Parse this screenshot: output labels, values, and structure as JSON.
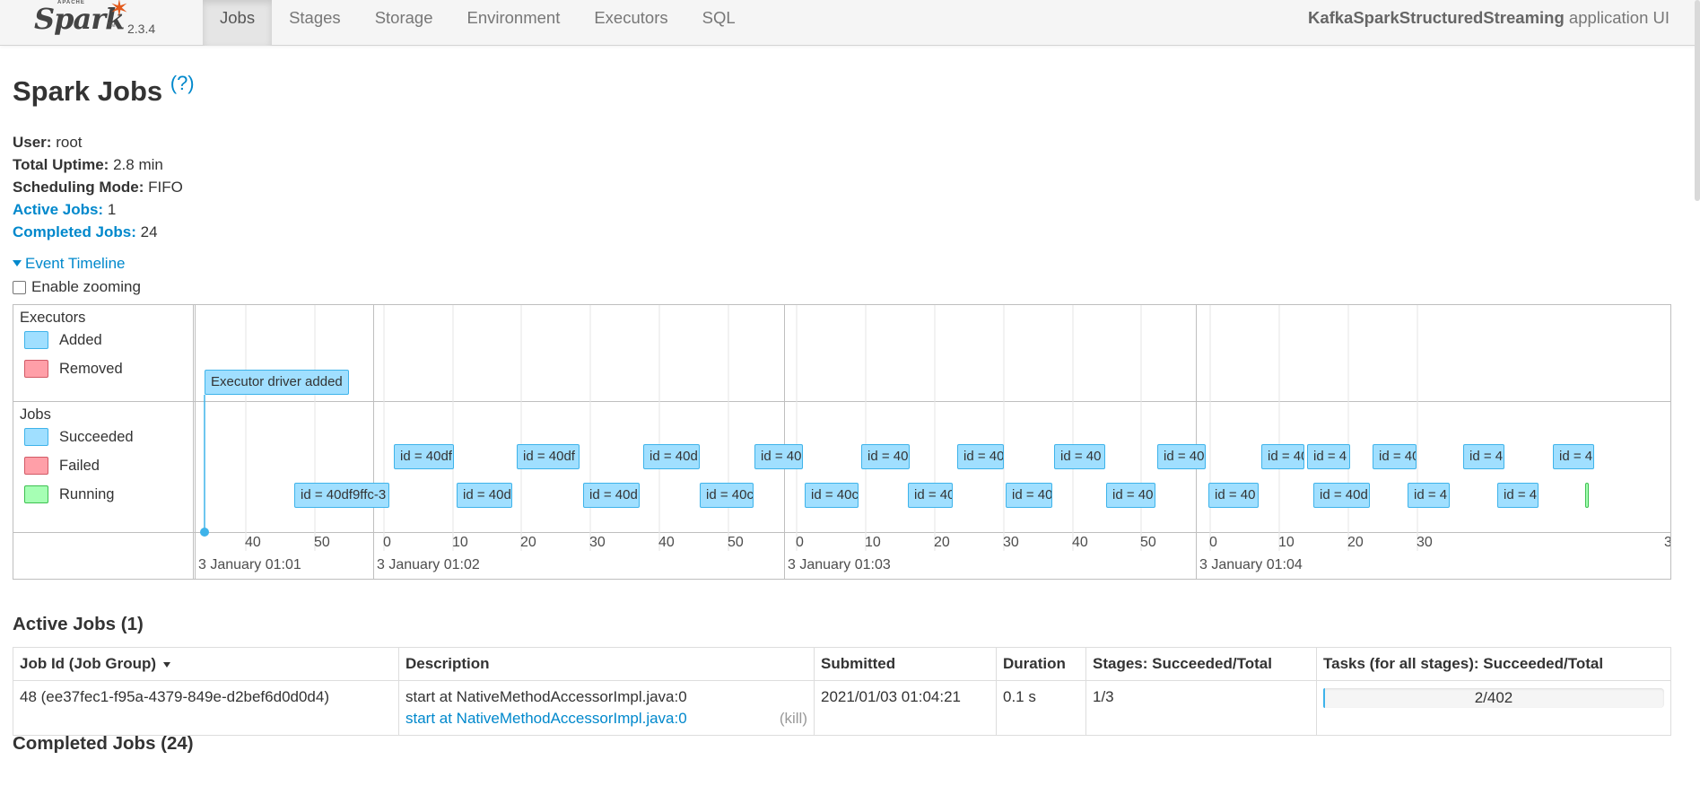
{
  "navbar": {
    "brand_apache": "APACHE",
    "brand_name": "Spark",
    "brand_tm": "TM",
    "version": "2.3.4",
    "tabs": [
      {
        "label": "Jobs",
        "active": true
      },
      {
        "label": "Stages"
      },
      {
        "label": "Storage"
      },
      {
        "label": "Environment"
      },
      {
        "label": "Executors"
      },
      {
        "label": "SQL"
      }
    ],
    "app_name": "KafkaSparkStructuredStreaming",
    "app_suffix": " application UI"
  },
  "header": {
    "title": "Spark Jobs",
    "help": "(?)"
  },
  "summary": {
    "user_label": "User:",
    "user": "root",
    "uptime_label": "Total Uptime:",
    "uptime": "2.8 min",
    "scheduling_label": "Scheduling Mode:",
    "scheduling": "FIFO",
    "active_label": "Active Jobs:",
    "active": "1",
    "completed_label": "Completed Jobs:",
    "completed": "24"
  },
  "timeline": {
    "toggle_label": "Event Timeline",
    "zoom_label": "Enable zooming",
    "zoom_checked": false,
    "executors_title": "Executors",
    "executors_legend": [
      {
        "label": "Added",
        "color": "#a0dfff"
      },
      {
        "label": "Removed",
        "color": "#ff9fa8"
      }
    ],
    "jobs_title": "Jobs",
    "jobs_legend": [
      {
        "label": "Succeeded",
        "color": "#a0dfff"
      },
      {
        "label": "Failed",
        "color": "#ff9fa8"
      },
      {
        "label": "Running",
        "color": "#a6ffb4"
      }
    ],
    "executor_event": "Executor driver added",
    "job_items": [
      {
        "label": "id = 40df9ffc-3",
        "status": "succeeded"
      },
      {
        "label": "id = 40df",
        "status": "succeeded"
      },
      {
        "label": "id = 40d",
        "status": "succeeded"
      },
      {
        "label": "id = 40df",
        "status": "succeeded"
      },
      {
        "label": "id = 40d",
        "status": "succeeded"
      },
      {
        "label": "id = 40d",
        "status": "succeeded"
      },
      {
        "label": "id = 40c",
        "status": "succeeded"
      },
      {
        "label": "id = 40",
        "status": "succeeded"
      },
      {
        "label": "id = 40c",
        "status": "succeeded"
      },
      {
        "label": "id = 40",
        "status": "succeeded"
      },
      {
        "label": "id = 40",
        "status": "succeeded"
      },
      {
        "label": "id = 40",
        "status": "succeeded"
      },
      {
        "label": "id = 40",
        "status": "succeeded"
      },
      {
        "label": "id = 40",
        "status": "succeeded"
      },
      {
        "label": "id = 40",
        "status": "succeeded"
      },
      {
        "label": "id = 40",
        "status": "succeeded"
      },
      {
        "label": "id = 40",
        "status": "succeeded"
      },
      {
        "label": "id = 40",
        "status": "succeeded"
      },
      {
        "label": "id = 4",
        "status": "succeeded"
      },
      {
        "label": "id = 40d",
        "status": "succeeded"
      },
      {
        "label": "id = 40",
        "status": "succeeded"
      },
      {
        "label": "id = 4",
        "status": "succeeded"
      },
      {
        "label": "id = 4",
        "status": "succeeded"
      },
      {
        "label": "id = 4",
        "status": "succeeded"
      },
      {
        "label": "id = 4",
        "status": "succeeded"
      },
      {
        "label": "",
        "status": "running"
      }
    ],
    "minor_ticks": [
      "40",
      "50",
      "0",
      "10",
      "20",
      "30",
      "40",
      "50",
      "0",
      "10",
      "20",
      "30",
      "40",
      "50",
      "0",
      "10",
      "20",
      "30"
    ],
    "major_ticks": [
      "3 January 01:01",
      "3 January 01:02",
      "3 January 01:03",
      "3 January 01:04"
    ]
  },
  "active_jobs": {
    "title": "Active Jobs (1)",
    "columns": [
      "Job Id (Job Group)",
      "Description",
      "Submitted",
      "Duration",
      "Stages: Succeeded/Total",
      "Tasks (for all stages): Succeeded/Total"
    ],
    "rows": [
      {
        "job_id": "48 (ee37fec1-f95a-4379-849e-d2bef6d0d0d4)",
        "desc_text": "start at NativeMethodAccessorImpl.java:0",
        "desc_link": "start at NativeMethodAccessorImpl.java:0",
        "kill": "(kill)",
        "submitted": "2021/01/03 01:04:21",
        "duration": "0.1 s",
        "stages": "1/3",
        "tasks": "2/402",
        "tasks_progress": 0.005
      }
    ]
  },
  "completed_jobs": {
    "title": "Completed Jobs (24)"
  }
}
